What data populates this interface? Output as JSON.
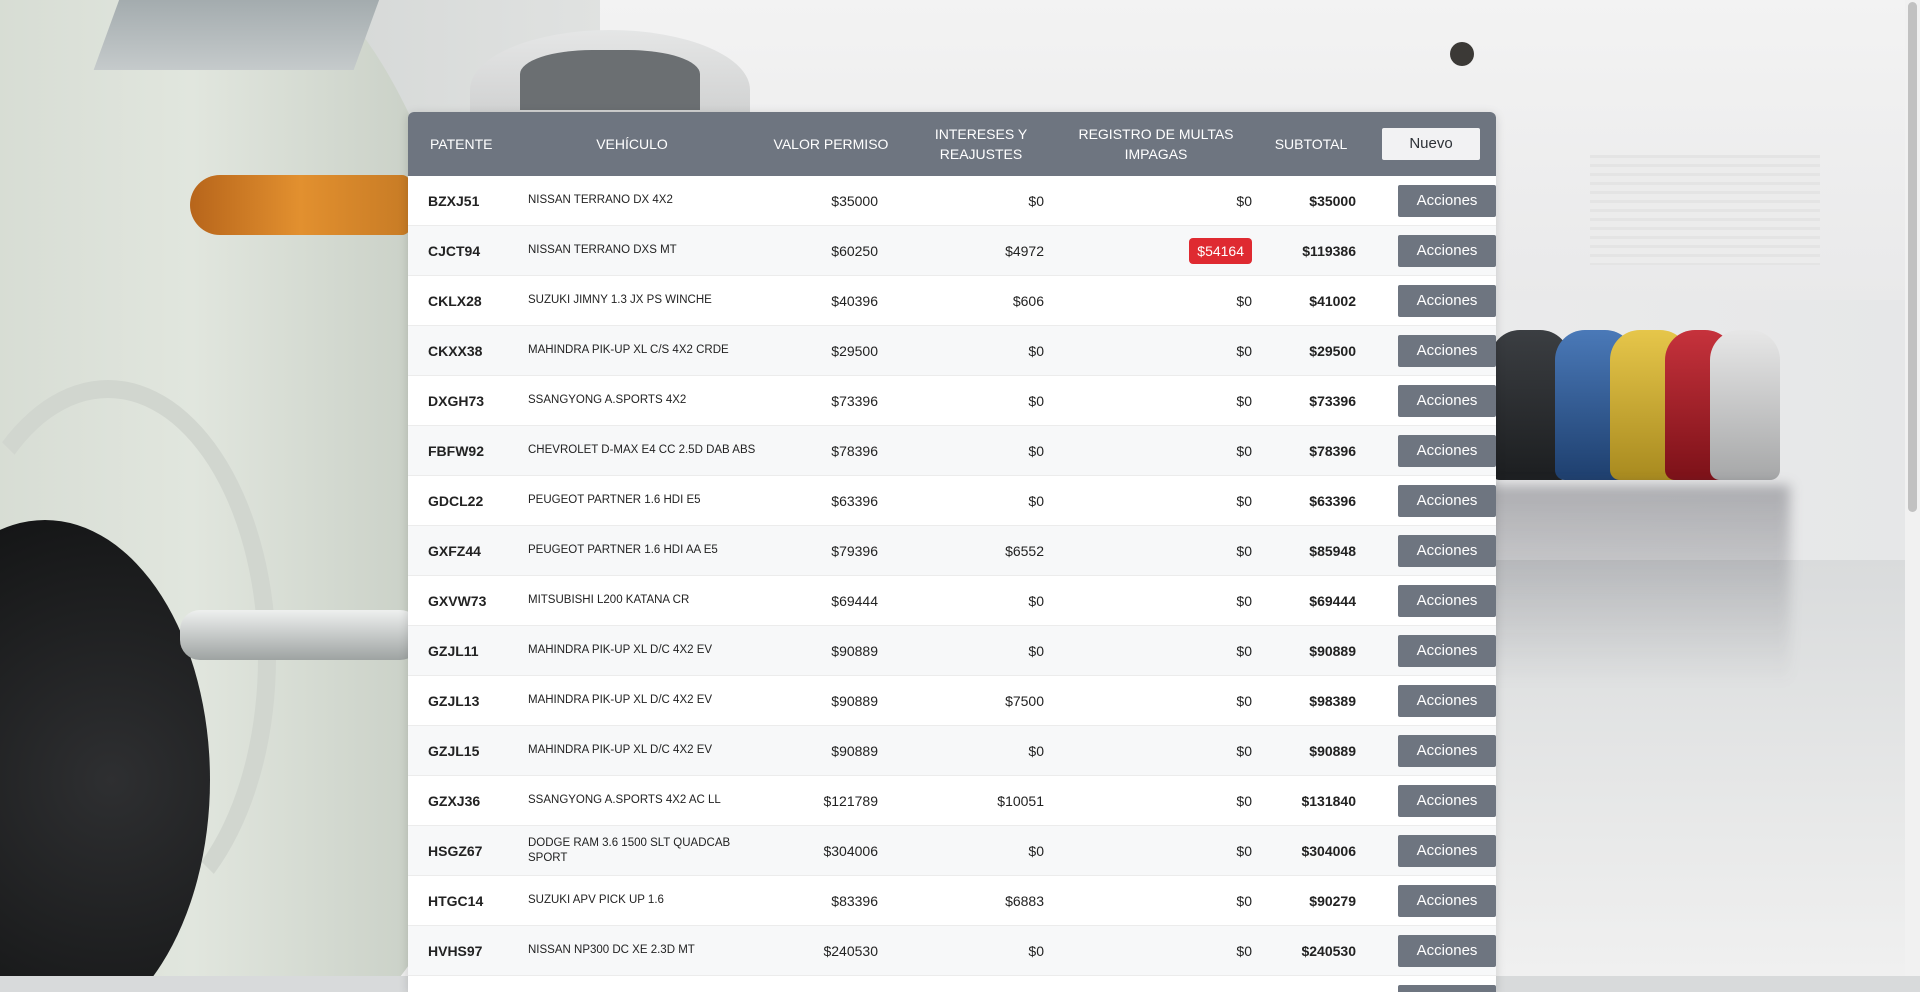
{
  "table": {
    "headers": {
      "patente": "PATENTE",
      "vehiculo": "VEHÍCULO",
      "valor_permiso": "VALOR PERMISO",
      "intereses": "INTERESES Y REAJUSTES",
      "registro_multas": "REGISTRO DE MULTAS IMPAGAS",
      "subtotal": "SUBTOTAL"
    },
    "new_button_label": "Nuevo",
    "action_button_label": "Acciones",
    "multa_badge_color": "#df2a31",
    "rows": [
      {
        "patente": "BZXJ51",
        "vehiculo": "NISSAN TERRANO DX 4X2",
        "valor": "$35000",
        "intereses": "$0",
        "multas": "$0",
        "subtotal": "$35000",
        "multa_alert": false
      },
      {
        "patente": "CJCT94",
        "vehiculo": "NISSAN TERRANO DXS MT",
        "valor": "$60250",
        "intereses": "$4972",
        "multas": "$54164",
        "subtotal": "$119386",
        "multa_alert": true
      },
      {
        "patente": "CKLX28",
        "vehiculo": "SUZUKI JIMNY 1.3 JX PS WINCHE",
        "valor": "$40396",
        "intereses": "$606",
        "multas": "$0",
        "subtotal": "$41002",
        "multa_alert": false
      },
      {
        "patente": "CKXX38",
        "vehiculo": "MAHINDRA PIK-UP XL C/S 4X2 CRDE",
        "valor": "$29500",
        "intereses": "$0",
        "multas": "$0",
        "subtotal": "$29500",
        "multa_alert": false
      },
      {
        "patente": "DXGH73",
        "vehiculo": "SSANGYONG A.SPORTS 4X2",
        "valor": "$73396",
        "intereses": "$0",
        "multas": "$0",
        "subtotal": "$73396",
        "multa_alert": false
      },
      {
        "patente": "FBFW92",
        "vehiculo": "CHEVROLET D-MAX E4 CC 2.5D DAB ABS",
        "valor": "$78396",
        "intereses": "$0",
        "multas": "$0",
        "subtotal": "$78396",
        "multa_alert": false
      },
      {
        "patente": "GDCL22",
        "vehiculo": "PEUGEOT PARTNER 1.6 HDI E5",
        "valor": "$63396",
        "intereses": "$0",
        "multas": "$0",
        "subtotal": "$63396",
        "multa_alert": false
      },
      {
        "patente": "GXFZ44",
        "vehiculo": "PEUGEOT PARTNER 1.6 HDI AA E5",
        "valor": "$79396",
        "intereses": "$6552",
        "multas": "$0",
        "subtotal": "$85948",
        "multa_alert": false
      },
      {
        "patente": "GXVW73",
        "vehiculo": "MITSUBISHI L200 KATANA CR",
        "valor": "$69444",
        "intereses": "$0",
        "multas": "$0",
        "subtotal": "$69444",
        "multa_alert": false
      },
      {
        "patente": "GZJL11",
        "vehiculo": "MAHINDRA PIK-UP XL D/C 4X2 EV",
        "valor": "$90889",
        "intereses": "$0",
        "multas": "$0",
        "subtotal": "$90889",
        "multa_alert": false
      },
      {
        "patente": "GZJL13",
        "vehiculo": "MAHINDRA PIK-UP XL D/C 4X2 EV",
        "valor": "$90889",
        "intereses": "$7500",
        "multas": "$0",
        "subtotal": "$98389",
        "multa_alert": false
      },
      {
        "patente": "GZJL15",
        "vehiculo": "MAHINDRA PIK-UP XL D/C 4X2 EV",
        "valor": "$90889",
        "intereses": "$0",
        "multas": "$0",
        "subtotal": "$90889",
        "multa_alert": false
      },
      {
        "patente": "GZXJ36",
        "vehiculo": "SSANGYONG A.SPORTS 4X2 AC LL",
        "valor": "$121789",
        "intereses": "$10051",
        "multas": "$0",
        "subtotal": "$131840",
        "multa_alert": false
      },
      {
        "patente": "HSGZ67",
        "vehiculo": "DODGE RAM 3.6 1500 SLT QUADCAB SPORT",
        "valor": "$304006",
        "intereses": "$0",
        "multas": "$0",
        "subtotal": "$304006",
        "multa_alert": false
      },
      {
        "patente": "HTGC14",
        "vehiculo": "SUZUKI APV PICK UP 1.6",
        "valor": "$83396",
        "intereses": "$6883",
        "multas": "$0",
        "subtotal": "$90279",
        "multa_alert": false
      },
      {
        "patente": "HVHS97",
        "vehiculo": "NISSAN NP300 DC XE 2.3D MT",
        "valor": "$240530",
        "intereses": "$0",
        "multas": "$0",
        "subtotal": "$240530",
        "multa_alert": false
      },
      {
        "patente": "",
        "vehiculo": "",
        "valor": "",
        "intereses": "",
        "multas": "",
        "subtotal": "",
        "multa_alert": false
      }
    ]
  }
}
